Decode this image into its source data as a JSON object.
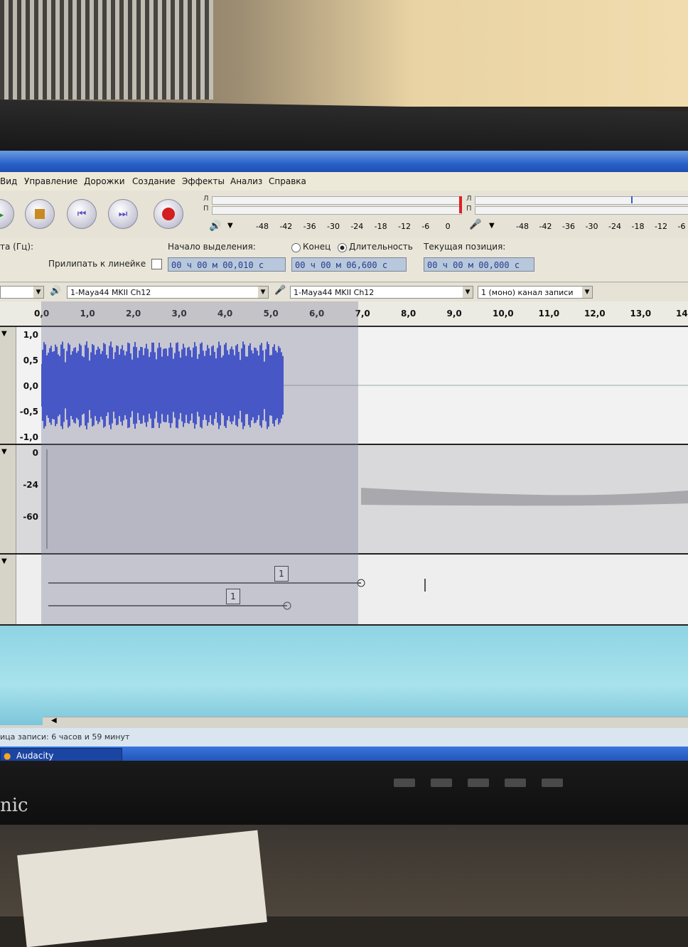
{
  "app": {
    "name": "Audacity"
  },
  "menu": [
    "Вид",
    "Управление",
    "Дорожки",
    "Создание",
    "Эффекты",
    "Анализ",
    "Справка"
  ],
  "toolbar": {
    "buttons": [
      "play",
      "stop",
      "skip-start",
      "skip-end",
      "record"
    ],
    "meter_left_label": "Л",
    "meter_right_label": "П",
    "playback_scale": [
      "-48",
      "-42",
      "-36",
      "-30",
      "-24",
      "-18",
      "-12",
      "-6",
      "0"
    ],
    "record_scale": [
      "-48",
      "-42",
      "-36",
      "-30",
      "-24",
      "-18",
      "-12",
      "-6"
    ]
  },
  "selection_bar": {
    "rate_label": "та (Гц):",
    "snap_label": "Прилипать к линейке",
    "start_label": "Начало выделения:",
    "end_label": "Конец",
    "length_label": "Длительность",
    "position_label": "Текущая позиция:",
    "start_value": "00 ч 00 м 00,010 с",
    "length_value": "00 ч 00 м 06,600 с",
    "position_value": "00 ч 00 м 00,000 с"
  },
  "device_bar": {
    "playback_device": "1-Maya44 MKII Ch12",
    "recording_device": "1-Maya44 MKII Ch12",
    "channels": "1 (моно) канал записи"
  },
  "ruler": [
    "0,0",
    "1,0",
    "2,0",
    "3,0",
    "4,0",
    "5,0",
    "6,0",
    "7,0",
    "8,0",
    "9,0",
    "10,0",
    "11,0",
    "12,0",
    "13,0",
    "14"
  ],
  "track1": {
    "y_labels": [
      "1,0",
      "0,5",
      "0,0",
      "-0,5",
      "-1,0"
    ]
  },
  "track2": {
    "y_labels": [
      "0",
      "-24",
      "-60"
    ]
  },
  "label_track": {
    "labels": [
      "1",
      "1"
    ]
  },
  "status": {
    "text": "ица записи: 6 часов и 59 минут"
  },
  "taskbar": {
    "item": "Audacity"
  },
  "monitor": {
    "brand": "nic"
  }
}
